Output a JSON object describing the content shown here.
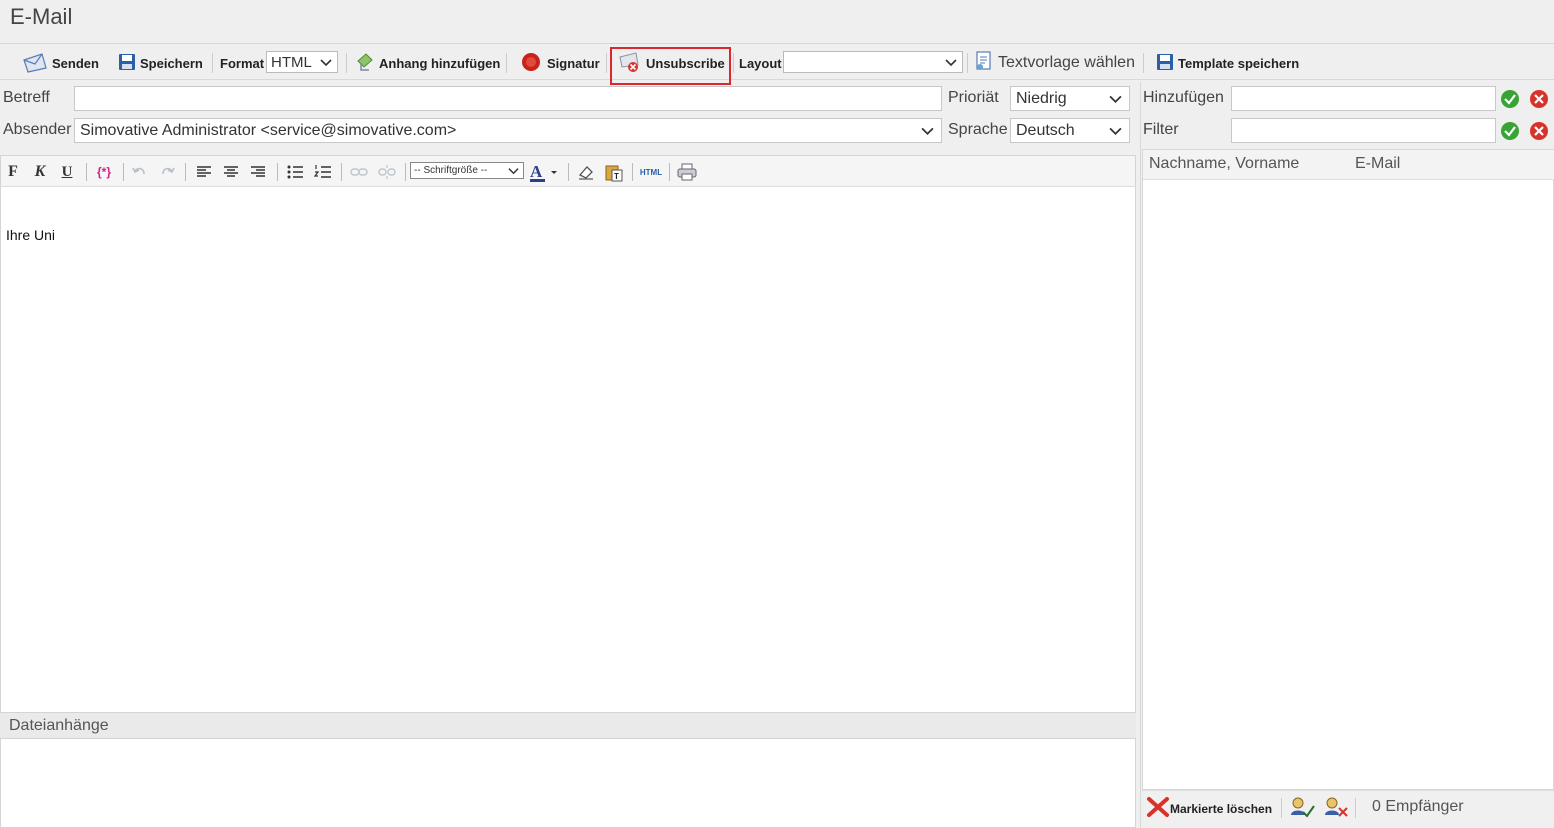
{
  "window": {
    "title": "E-Mail"
  },
  "toolbar": {
    "send": "Senden",
    "save": "Speichern",
    "format_label": "Format",
    "format_value": "HTML",
    "attachment": "Anhang hinzufügen",
    "signature": "Signatur",
    "unsubscribe": "Unsubscribe",
    "layout_label": "Layout",
    "layout_value": "",
    "template_choose": "Textvorlage wählen",
    "template_save": "Template speichern"
  },
  "form": {
    "subject_label": "Betreff",
    "subject_value": "",
    "sender_label": "Absender",
    "sender_value": "Simovative Administrator <service@simovative.com>",
    "priority_label": "Prioriät",
    "priority_value": "Niedrig",
    "language_label": "Sprache",
    "language_value": "Deutsch"
  },
  "editor": {
    "font_size_select": "-- Schriftgröße --",
    "body_text": "Ihre Uni"
  },
  "attachments": {
    "header": "Dateianhänge"
  },
  "recipients": {
    "add_label": "Hinzufügen",
    "filter_label": "Filter",
    "col_name": "Nachname, Vorname",
    "col_email": "E-Mail",
    "delete_marked": "Markierte löschen",
    "count": "0 Empfänger"
  },
  "colors": {
    "highlight": "#d9282f",
    "accent_blue": "#2b5fa8",
    "ok_green": "#3aa335",
    "cancel_red": "#d8332b"
  }
}
